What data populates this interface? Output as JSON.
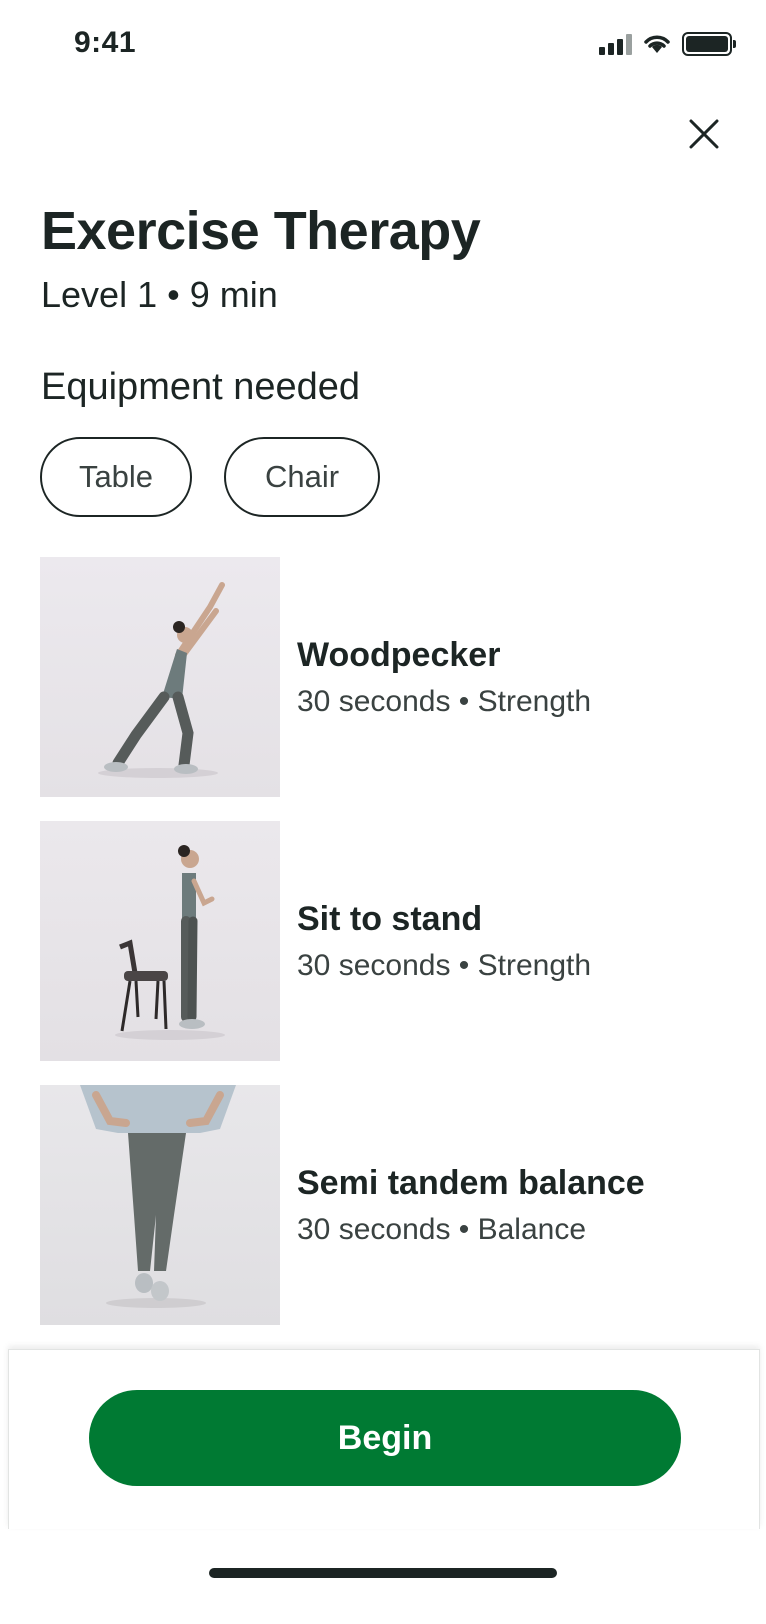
{
  "status_bar": {
    "time": "9:41",
    "icons": [
      "cellular-signal-icon",
      "wifi-icon",
      "battery-icon"
    ]
  },
  "header": {
    "close_icon": "close-icon",
    "title": "Exercise Therapy",
    "subtitle": "Level 1 • 9 min"
  },
  "equipment": {
    "heading": "Equipment needed",
    "items": [
      "Table",
      "Chair"
    ]
  },
  "exercises": [
    {
      "name": "Woodpecker",
      "meta": "30 seconds • Strength"
    },
    {
      "name": "Sit to stand",
      "meta": "30 seconds • Strength"
    },
    {
      "name": "Semi tandem balance",
      "meta": "30 seconds • Balance"
    }
  ],
  "footer": {
    "begin_label": "Begin"
  },
  "colors": {
    "primary_green": "#007a33",
    "text_dark": "#1c2524",
    "text_muted": "#3a4241"
  }
}
